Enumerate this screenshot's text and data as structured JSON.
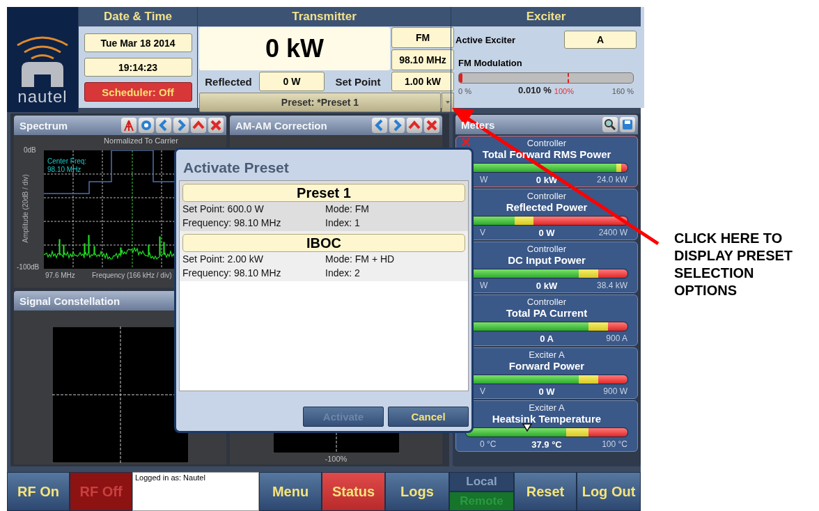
{
  "logo": {
    "text": "nautel"
  },
  "date_time": {
    "title": "Date & Time",
    "date": "Tue Mar 18 2014",
    "time": "19:14:23",
    "scheduler": "Scheduler: Off"
  },
  "transmitter": {
    "title": "Transmitter",
    "power": "0 kW",
    "mode": "FM",
    "frequency": "98.10 MHz",
    "reflected_label": "Reflected",
    "reflected": "0 W",
    "set_point_label": "Set Point",
    "set_point": "1.00 kW",
    "preset": "Preset: *Preset 1"
  },
  "exciter": {
    "title": "Exciter",
    "active_label": "Active Exciter",
    "active": "A",
    "modulation_label": "FM Modulation",
    "level": 0.02,
    "scale_min": "0 %",
    "reading": "0.010 %",
    "limit": "100%",
    "scale_max": "160 %"
  },
  "spectrum": {
    "title": "Spectrum",
    "subtitle": "Normalized To Carrier",
    "y_top": "0dB",
    "y_bottom": "-100dB",
    "ylabel": "Amplitude (20dB / div)",
    "x_start": "97.6 MHz",
    "xlabel": "Frequency (166 kHz / div)",
    "center_label": "Center Freq:",
    "center_value": "98.10 MHz"
  },
  "am_am": {
    "title": "AM-AM Correction",
    "bottom_label": "-100%"
  },
  "constellation": {
    "title": "Signal Constellation"
  },
  "meters": {
    "title": "Meters",
    "items": [
      {
        "group": "Controller",
        "name": "Total Forward RMS Power",
        "kind": "forward",
        "alarm": true,
        "min": "W",
        "value": "0 kW",
        "max": "24.0 kW"
      },
      {
        "group": "Controller",
        "name": "Reflected Power",
        "kind": "reflected",
        "alarm": false,
        "min": "V",
        "value": "0 W",
        "max": "2400 W"
      },
      {
        "group": "Controller",
        "name": "DC Input Power",
        "kind": "standard",
        "alarm": false,
        "min": "W",
        "value": "0 kW",
        "max": "38.4 kW"
      },
      {
        "group": "Controller",
        "name": "Total PA Current",
        "kind": "current",
        "alarm": false,
        "value": "0 A",
        "max": "900 A"
      },
      {
        "group": "Exciter A",
        "name": "Forward Power",
        "kind": "standard",
        "alarm": false,
        "min": "V",
        "value": "0 W",
        "max": "900 W"
      },
      {
        "group": "Exciter A",
        "name": "Heatsink Temperature",
        "kind": "temperature",
        "alarm": false,
        "level": 0.38,
        "min": "0 °C",
        "value": "37.9 °C",
        "max": "100 °C"
      }
    ]
  },
  "dialog": {
    "title": "Activate Preset",
    "presets": [
      {
        "name": "Preset 1",
        "set_point": "Set Point: 600.0 W",
        "mode": "Mode: FM",
        "frequency": "Frequency: 98.10 MHz",
        "index": "Index: 1"
      },
      {
        "name": "IBOC",
        "set_point": "Set Point: 2.00 kW",
        "mode": "Mode: FM + HD",
        "frequency": "Frequency: 98.10 MHz",
        "index": "Index: 2"
      }
    ],
    "buttons": [
      {
        "label": "Activate",
        "disabled": true
      },
      {
        "label": "Cancel",
        "disabled": false
      }
    ]
  },
  "footer": {
    "login": "Logged in as: Nautel",
    "buttons": [
      {
        "kind": "normal",
        "label": "RF On",
        "disabled": false
      },
      {
        "kind": "danger",
        "label": "RF Off",
        "disabled": true
      },
      {
        "kind": "login"
      },
      {
        "kind": "normal",
        "label": "Menu",
        "disabled": false
      },
      {
        "kind": "danger",
        "label": "Status",
        "disabled": false
      },
      {
        "kind": "normal",
        "label": "Logs",
        "disabled": false
      },
      {
        "kind": "toggle",
        "options": [
          {
            "label": "Local",
            "selected": false
          },
          {
            "label": "Remote",
            "selected": true
          }
        ]
      },
      {
        "kind": "normal",
        "label": "Reset",
        "disabled": false
      },
      {
        "kind": "normal",
        "label": "Log Out",
        "disabled": false
      }
    ]
  },
  "annotation": {
    "text": "CLICK HERE TO DISPLAY PRESET SELECTION OPTIONS"
  }
}
